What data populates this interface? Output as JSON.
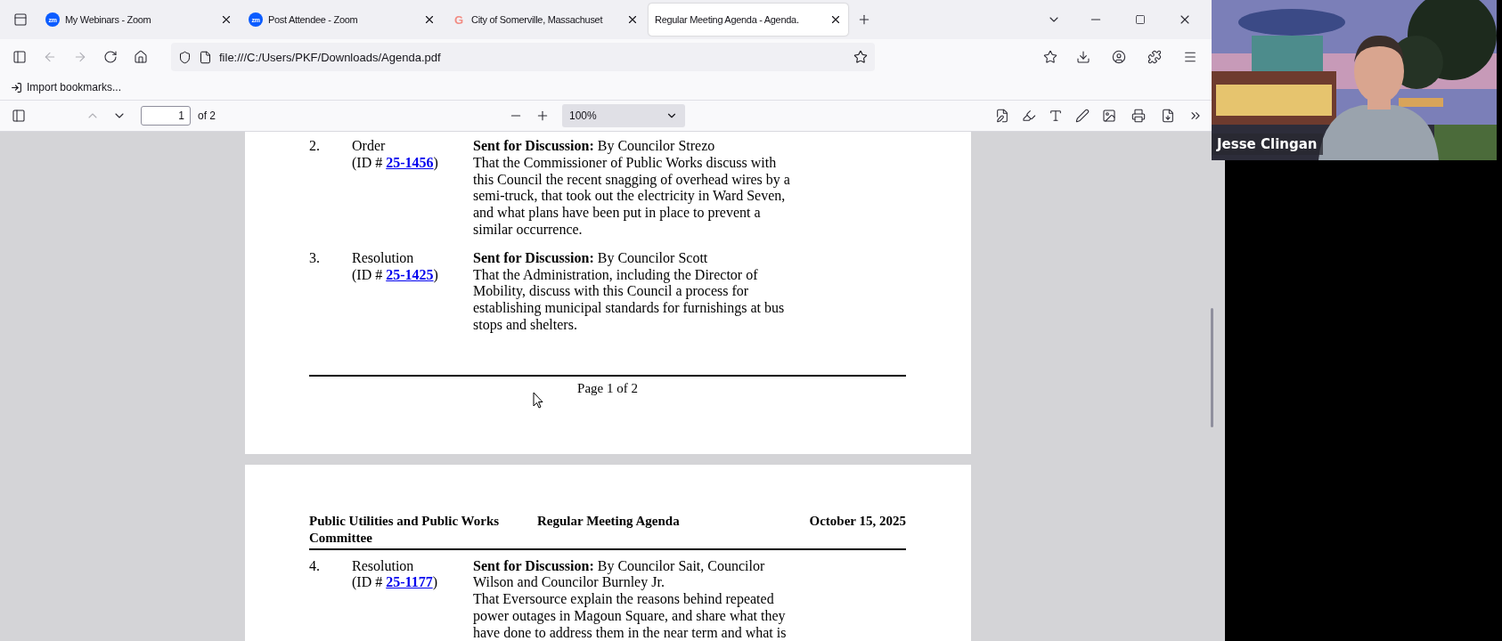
{
  "tabs": [
    {
      "label": "My Webinars - Zoom",
      "logo": "zm",
      "selected": false
    },
    {
      "label": "Post Attendee - Zoom",
      "logo": "zm",
      "selected": false
    },
    {
      "label": "City of Somerville, Massachuset",
      "logo": "G",
      "selected": false
    },
    {
      "label": "Regular Meeting Agenda - Agenda.",
      "selected": true
    }
  ],
  "nav": {
    "url": "file:///C:/Users/PKF/Downloads/Agenda.pdf",
    "back_disabled": true,
    "forward_disabled": true
  },
  "bookmarks": [
    "Import bookmarks..."
  ],
  "pdf_toolbar": {
    "page": "1",
    "page_count": "of 2",
    "zoom": "100%",
    "previous_disabled": true
  },
  "pages": [
    {
      "items": [
        {
          "number": "2.",
          "type": "Order",
          "id_open": "(ID #",
          "id": "25-1456",
          "id_close": ")",
          "heading": "**Sent for Discussion:** By Councilor Strezo",
          "body": "That the Commissioner of Public Works discuss with this Council the recent snagging of overhead wires by a semi-truck, that took out the electricity in Ward Seven, and what plans have been put in place to prevent a similar occurrence."
        },
        {
          "number": "3.",
          "type": "Resolution",
          "id_open": "(ID #",
          "id": "25-1425",
          "id_close": ")",
          "heading": "**Sent for Discussion:** By Councilor Scott",
          "body": "That the Administration, including the Director of Mobility, discuss with this Council a process for establishing municipal standards for furnishings at bus stops and shelters."
        }
      ],
      "footer": "Page 1 of 2"
    },
    {
      "header": {
        "committee": "Public Utilities and Public Works Committee",
        "title": "Regular Meeting Agenda",
        "date": "October 15, 2025"
      },
      "items": [
        {
          "number": "4.",
          "type": "Resolution",
          "id_open": "(ID #",
          "id": "25-1177",
          "id_close": ")",
          "heading": "**Sent for Discussion:** By Councilor Sait, Councilor Wilson and Councilor Burnley Jr.",
          "body": "That Eversource explain the reasons behind repeated power outages in Magoun Square, and share what they have done to address them in the near term and what is"
        }
      ]
    }
  ],
  "video": {
    "name": "Jesse Clingan"
  }
}
